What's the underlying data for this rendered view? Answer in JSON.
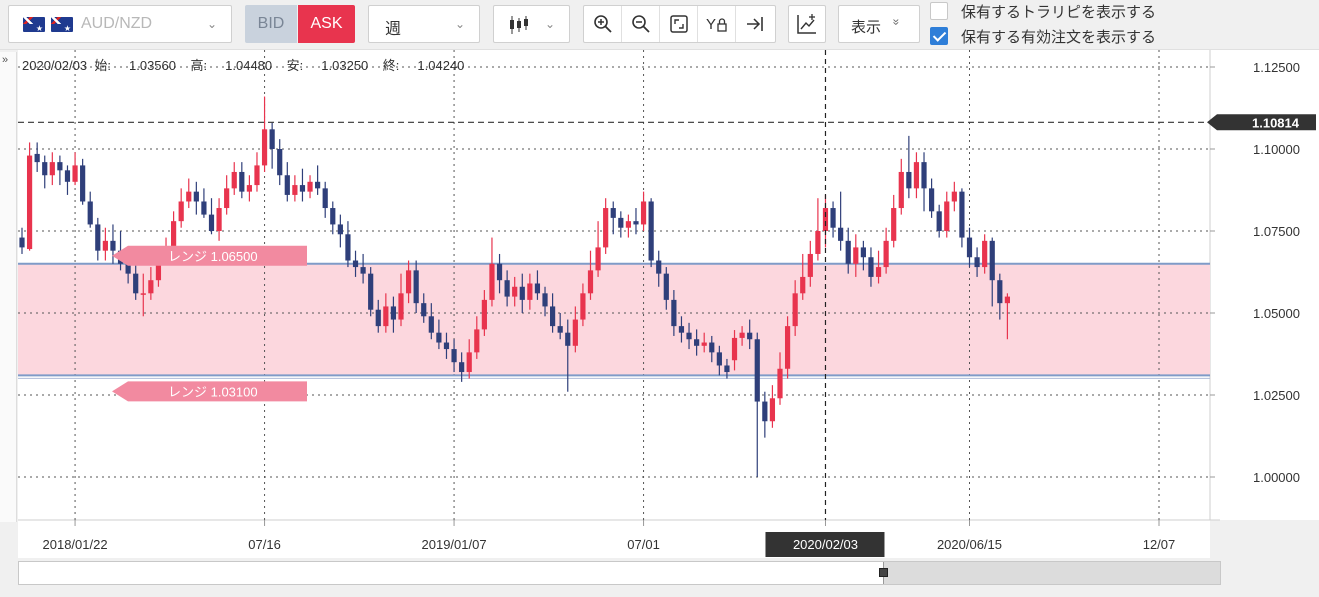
{
  "toolbar": {
    "symbol": "AUD/NZD",
    "bid_label": "BID",
    "ask_label": "ASK",
    "period": "週",
    "display_label": "表示",
    "display_chevron": "»",
    "checkbox_trailing_stop": {
      "label": "保有するトラリピを表示する",
      "checked": false
    },
    "checkbox_orders": {
      "label": "保有する有効注文を表示する",
      "checked": true
    },
    "icons": [
      "zoom-in-icon",
      "zoom-out-icon",
      "fit-icon",
      "y-lock-icon",
      "scroll-right-icon",
      "add-indicator-icon"
    ]
  },
  "ohlc": {
    "date": "2020/02/03",
    "open_label": "始:",
    "open": "1.03560",
    "high_label": "高:",
    "high": "1.04480",
    "low_label": "安:",
    "low": "1.03250",
    "close_label": "終:",
    "close": "1.04240"
  },
  "expand_label": "»",
  "colors": {
    "bull": "#e8344e",
    "bear": "#2f3f7a",
    "range_fill": "#fcd7de",
    "range_label": "#f28aa0",
    "price_tag": "#333333"
  },
  "chart_data": {
    "type": "candlestick",
    "ylim": [
      0.99,
      1.132
    ],
    "y_ticks": [
      "1.12500",
      "1.10000",
      "1.07500",
      "1.05000",
      "1.02500",
      "1.00000"
    ],
    "y_tick_values": [
      1.125,
      1.1,
      1.075,
      1.05,
      1.025,
      1.0
    ],
    "x_ticks": [
      "2018/01/22",
      "07/16",
      "2019/01/07",
      "07/01",
      "2020/02/03",
      "2020/06/15",
      "12/07"
    ],
    "x_tick_index": [
      7,
      32,
      57,
      82,
      106,
      125,
      150
    ],
    "current_price": "1.10814",
    "current_price_value": 1.10814,
    "crosshair_date": "2020/02/03",
    "crosshair_index": 106,
    "ranges": [
      {
        "label": "レンジ 1.06500",
        "value": 1.065
      },
      {
        "label": "レンジ 1.03100",
        "value": 1.031
      }
    ],
    "candles": [
      [
        1.073,
        1.07,
        1.076,
        1.068
      ],
      [
        1.0695,
        1.098,
        1.102,
        1.069
      ],
      [
        1.0985,
        1.096,
        1.102,
        1.093
      ],
      [
        1.096,
        1.092,
        1.098,
        1.088
      ],
      [
        1.092,
        1.096,
        1.099,
        1.089
      ],
      [
        1.096,
        1.0935,
        1.098,
        1.089
      ],
      [
        1.0935,
        1.09,
        1.095,
        1.086
      ],
      [
        1.09,
        1.095,
        1.099,
        1.089
      ],
      [
        1.095,
        1.084,
        1.097,
        1.083
      ],
      [
        1.084,
        1.077,
        1.087,
        1.076
      ],
      [
        1.077,
        1.069,
        1.079,
        1.066
      ],
      [
        1.069,
        1.072,
        1.076,
        1.066
      ],
      [
        1.072,
        1.069,
        1.077,
        1.065
      ],
      [
        1.069,
        1.065,
        1.075,
        1.063
      ],
      [
        1.065,
        1.062,
        1.069,
        1.059
      ],
      [
        1.062,
        1.056,
        1.065,
        1.054
      ],
      [
        1.056,
        1.056,
        1.062,
        1.049
      ],
      [
        1.056,
        1.06,
        1.064,
        1.054
      ],
      [
        1.06,
        1.066,
        1.07,
        1.058
      ],
      [
        1.066,
        1.07,
        1.073,
        1.065
      ],
      [
        1.07,
        1.078,
        1.081,
        1.069
      ],
      [
        1.078,
        1.084,
        1.088,
        1.076
      ],
      [
        1.084,
        1.087,
        1.091,
        1.082
      ],
      [
        1.087,
        1.084,
        1.09,
        1.08
      ],
      [
        1.084,
        1.08,
        1.088,
        1.079
      ],
      [
        1.08,
        1.075,
        1.085,
        1.074
      ],
      [
        1.075,
        1.082,
        1.085,
        1.072
      ],
      [
        1.082,
        1.088,
        1.092,
        1.08
      ],
      [
        1.088,
        1.093,
        1.096,
        1.086
      ],
      [
        1.093,
        1.087,
        1.096,
        1.085
      ],
      [
        1.087,
        1.089,
        1.092,
        1.084
      ],
      [
        1.089,
        1.095,
        1.099,
        1.087
      ],
      [
        1.095,
        1.106,
        1.116,
        1.093
      ],
      [
        1.106,
        1.1,
        1.108,
        1.094
      ],
      [
        1.1,
        1.092,
        1.103,
        1.089
      ],
      [
        1.092,
        1.086,
        1.096,
        1.084
      ],
      [
        1.086,
        1.089,
        1.092,
        1.084
      ],
      [
        1.089,
        1.087,
        1.094,
        1.084
      ],
      [
        1.087,
        1.09,
        1.092,
        1.085
      ],
      [
        1.09,
        1.088,
        1.095,
        1.086
      ],
      [
        1.088,
        1.082,
        1.09,
        1.079
      ],
      [
        1.082,
        1.077,
        1.084,
        1.074
      ],
      [
        1.077,
        1.074,
        1.08,
        1.07
      ],
      [
        1.074,
        1.066,
        1.078,
        1.064
      ],
      [
        1.066,
        1.064,
        1.069,
        1.061
      ],
      [
        1.064,
        1.062,
        1.068,
        1.059
      ],
      [
        1.062,
        1.051,
        1.064,
        1.049
      ],
      [
        1.051,
        1.046,
        1.054,
        1.044
      ],
      [
        1.046,
        1.052,
        1.056,
        1.044
      ],
      [
        1.052,
        1.048,
        1.055,
        1.044
      ],
      [
        1.048,
        1.056,
        1.062,
        1.046
      ],
      [
        1.056,
        1.063,
        1.066,
        1.053
      ],
      [
        1.063,
        1.053,
        1.066,
        1.05
      ],
      [
        1.053,
        1.049,
        1.056,
        1.047
      ],
      [
        1.049,
        1.044,
        1.053,
        1.042
      ],
      [
        1.044,
        1.041,
        1.048,
        1.039
      ],
      [
        1.041,
        1.039,
        1.044,
        1.036
      ],
      [
        1.039,
        1.035,
        1.042,
        1.032
      ],
      [
        1.035,
        1.032,
        1.038,
        1.029
      ],
      [
        1.032,
        1.038,
        1.042,
        1.03
      ],
      [
        1.038,
        1.045,
        1.049,
        1.036
      ],
      [
        1.045,
        1.054,
        1.057,
        1.043
      ],
      [
        1.054,
        1.065,
        1.073,
        1.052
      ],
      [
        1.065,
        1.06,
        1.068,
        1.056
      ],
      [
        1.06,
        1.055,
        1.063,
        1.052
      ],
      [
        1.055,
        1.058,
        1.061,
        1.052
      ],
      [
        1.058,
        1.054,
        1.062,
        1.05
      ],
      [
        1.054,
        1.059,
        1.062,
        1.051
      ],
      [
        1.059,
        1.056,
        1.063,
        1.054
      ],
      [
        1.056,
        1.052,
        1.058,
        1.049
      ],
      [
        1.052,
        1.046,
        1.056,
        1.044
      ],
      [
        1.046,
        1.044,
        1.05,
        1.042
      ],
      [
        1.044,
        1.04,
        1.048,
        1.026
      ],
      [
        1.04,
        1.048,
        1.052,
        1.038
      ],
      [
        1.048,
        1.056,
        1.059,
        1.046
      ],
      [
        1.056,
        1.063,
        1.069,
        1.054
      ],
      [
        1.063,
        1.07,
        1.078,
        1.061
      ],
      [
        1.07,
        1.082,
        1.085,
        1.068
      ],
      [
        1.082,
        1.079,
        1.084,
        1.074
      ],
      [
        1.079,
        1.076,
        1.081,
        1.073
      ],
      [
        1.076,
        1.078,
        1.08,
        1.073
      ],
      [
        1.078,
        1.077,
        1.082,
        1.074
      ],
      [
        1.077,
        1.084,
        1.087,
        1.075
      ],
      [
        1.084,
        1.066,
        1.085,
        1.064
      ],
      [
        1.066,
        1.062,
        1.069,
        1.058
      ],
      [
        1.062,
        1.054,
        1.064,
        1.051
      ],
      [
        1.054,
        1.046,
        1.057,
        1.043
      ],
      [
        1.046,
        1.044,
        1.049,
        1.041
      ],
      [
        1.044,
        1.042,
        1.047,
        1.039
      ],
      [
        1.042,
        1.04,
        1.045,
        1.037
      ],
      [
        1.04,
        1.041,
        1.044,
        1.038
      ],
      [
        1.041,
        1.038,
        1.043,
        1.035
      ],
      [
        1.038,
        1.034,
        1.04,
        1.031
      ],
      [
        1.034,
        1.032,
        1.036,
        1.03
      ],
      [
        1.0356,
        1.0424,
        1.0448,
        1.0325
      ],
      [
        1.0424,
        1.044,
        1.046,
        1.04
      ],
      [
        1.044,
        1.042,
        1.048,
        1.039
      ],
      [
        1.042,
        1.023,
        1.044,
        1.0
      ],
      [
        1.023,
        1.017,
        1.026,
        1.012
      ],
      [
        1.017,
        1.024,
        1.028,
        1.015
      ],
      [
        1.024,
        1.033,
        1.038,
        1.022
      ],
      [
        1.033,
        1.046,
        1.049,
        1.03
      ],
      [
        1.046,
        1.056,
        1.06,
        1.043
      ],
      [
        1.056,
        1.061,
        1.068,
        1.054
      ],
      [
        1.061,
        1.068,
        1.072,
        1.058
      ],
      [
        1.068,
        1.075,
        1.085,
        1.066
      ],
      [
        1.075,
        1.082,
        1.086,
        1.07
      ],
      [
        1.082,
        1.076,
        1.084,
        1.073
      ],
      [
        1.076,
        1.072,
        1.087,
        1.069
      ],
      [
        1.072,
        1.065,
        1.076,
        1.062
      ],
      [
        1.065,
        1.07,
        1.074,
        1.061
      ],
      [
        1.07,
        1.067,
        1.072,
        1.063
      ],
      [
        1.067,
        1.061,
        1.07,
        1.058
      ],
      [
        1.061,
        1.064,
        1.069,
        1.059
      ],
      [
        1.064,
        1.072,
        1.076,
        1.062
      ],
      [
        1.072,
        1.082,
        1.086,
        1.07
      ],
      [
        1.082,
        1.093,
        1.097,
        1.08
      ],
      [
        1.093,
        1.088,
        1.104,
        1.085
      ],
      [
        1.088,
        1.096,
        1.099,
        1.085
      ],
      [
        1.096,
        1.088,
        1.099,
        1.081
      ],
      [
        1.088,
        1.081,
        1.091,
        1.079
      ],
      [
        1.081,
        1.075,
        1.083,
        1.073
      ],
      [
        1.075,
        1.084,
        1.087,
        1.073
      ],
      [
        1.084,
        1.087,
        1.09,
        1.081
      ],
      [
        1.087,
        1.073,
        1.088,
        1.07
      ],
      [
        1.073,
        1.067,
        1.076,
        1.064
      ],
      [
        1.067,
        1.064,
        1.07,
        1.061
      ],
      [
        1.064,
        1.072,
        1.074,
        1.062
      ],
      [
        1.072,
        1.06,
        1.073,
        1.052
      ],
      [
        1.06,
        1.053,
        1.062,
        1.048
      ],
      [
        1.053,
        1.055,
        1.056,
        1.042
      ]
    ]
  }
}
